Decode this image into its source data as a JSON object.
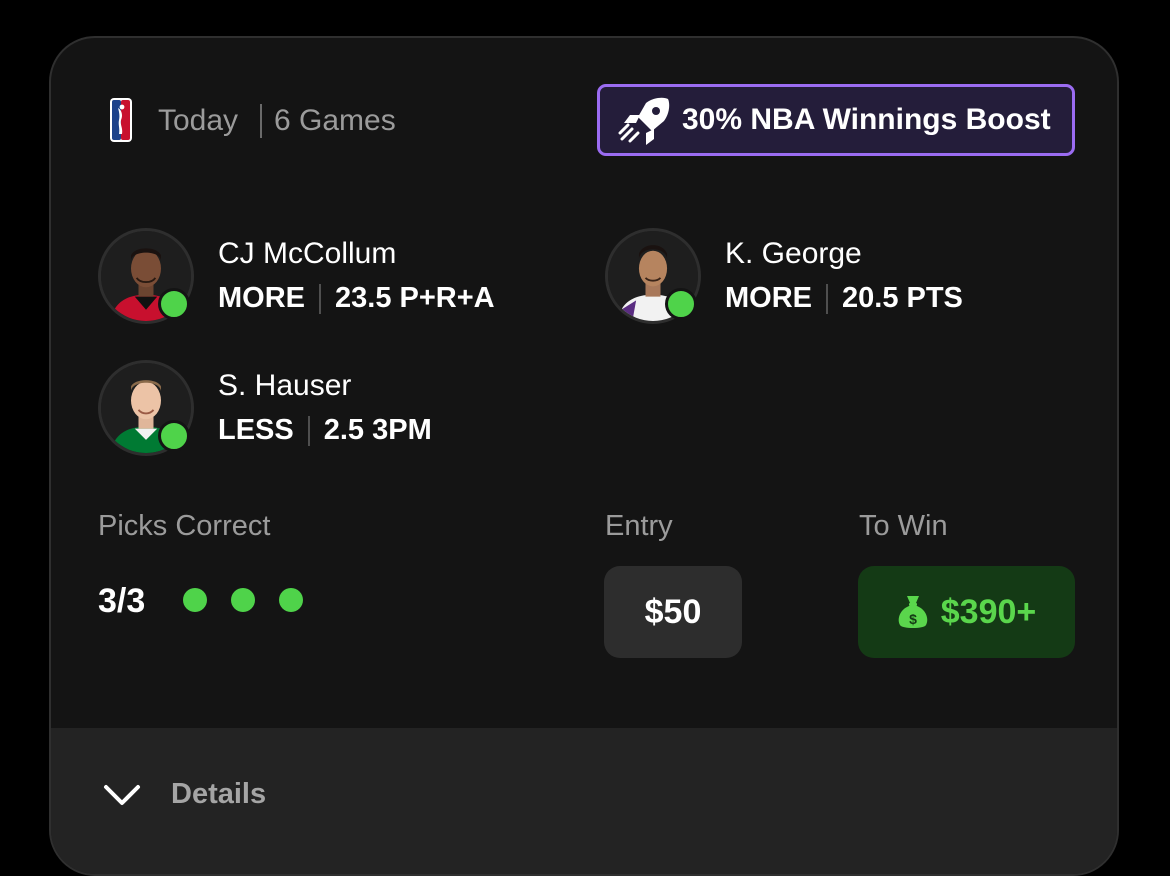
{
  "header": {
    "date": "Today",
    "games": "6 Games",
    "league_icon": "nba-logo-icon",
    "boost": {
      "icon": "rocket-icon",
      "label": "30% NBA Winnings Boost",
      "border_color": "#9b6cf2",
      "bg_color": "#241d3a"
    }
  },
  "picks": [
    {
      "player": "CJ McCollum",
      "direction": "MORE",
      "stat": "23.5 P+R+A",
      "status": "hit",
      "jersey_color": "#c8102e"
    },
    {
      "player": "K. George",
      "direction": "MORE",
      "stat": "20.5 PTS",
      "status": "hit",
      "jersey_color": "#ffffff"
    },
    {
      "player": "S. Hauser",
      "direction": "LESS",
      "stat": "2.5 3PM",
      "status": "hit",
      "jersey_color": "#007a33"
    }
  ],
  "summary": {
    "picks_correct_label": "Picks Correct",
    "picks_correct_value": "3/3",
    "correct_flags": [
      true,
      true,
      true
    ],
    "entry_label": "Entry",
    "entry_value": "$50",
    "to_win_label": "To Win",
    "to_win_value": "$390+",
    "to_win_icon": "money-bag-icon"
  },
  "footer": {
    "details_label": "Details",
    "details_icon": "chevron-down-icon"
  },
  "colors": {
    "accent_green": "#4fd34a",
    "win_text": "#5ad64c",
    "win_bg": "#143a15",
    "card_bg": "#141414"
  }
}
